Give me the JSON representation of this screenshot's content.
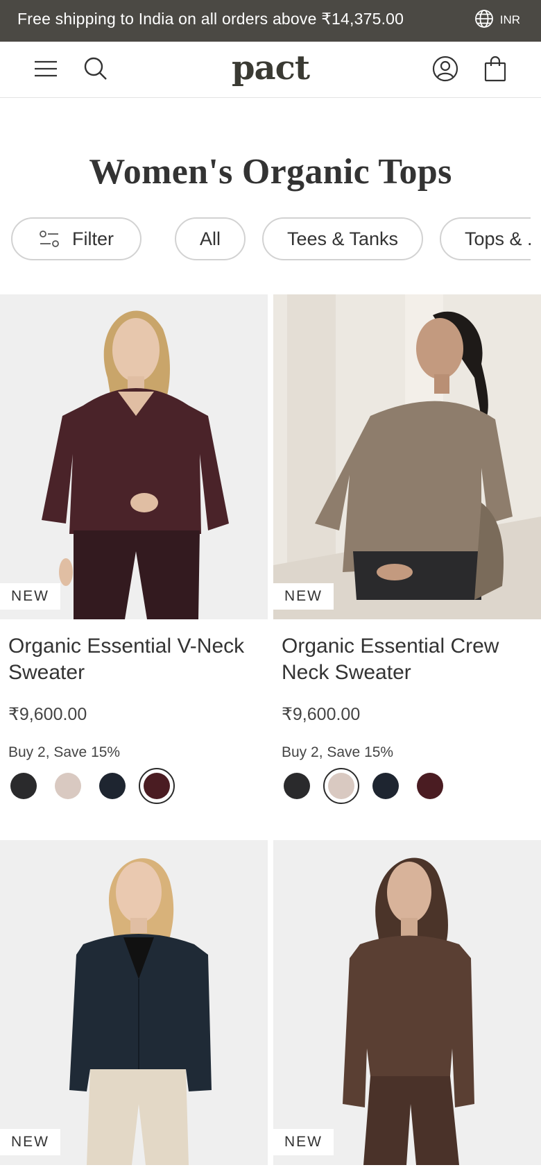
{
  "promo_bar": {
    "text": "Free shipping to India on all orders above ₹14,375.00",
    "currency": "INR"
  },
  "header": {
    "logo": "pact",
    "icons": [
      "menu-icon",
      "search-icon",
      "account-icon",
      "bag-icon"
    ]
  },
  "page": {
    "title": "Women's Organic Tops"
  },
  "filters": {
    "filter_label": "Filter",
    "pills": [
      "All",
      "Tees & Tanks",
      "Tops & ..."
    ]
  },
  "products": [
    {
      "badge": "NEW",
      "title": "Organic Essential V-Neck Sweater",
      "price": "₹9,600.00",
      "promo": "Buy 2, Save 15%",
      "swatches": [
        "#2a2a2c",
        "#d9c9c1",
        "#1e2530",
        "#4a1c22"
      ],
      "selected_swatch": 3
    },
    {
      "badge": "NEW",
      "title": "Organic Essential Crew Neck Sweater",
      "price": "₹9,600.00",
      "promo": "Buy 2, Save 15%",
      "swatches": [
        "#2a2a2c",
        "#d9c9c1",
        "#1e2530",
        "#4a1c22"
      ],
      "selected_swatch": 1
    },
    {
      "badge": "NEW"
    },
    {
      "badge": "NEW"
    }
  ],
  "colors": {
    "promo_bar_bg": "#4b4944",
    "sweater_burgundy": "#4a2329",
    "sweater_taupe": "#8e7d6c",
    "cardigan_navy": "#1f2a36",
    "top_brown": "#5a3f33"
  }
}
